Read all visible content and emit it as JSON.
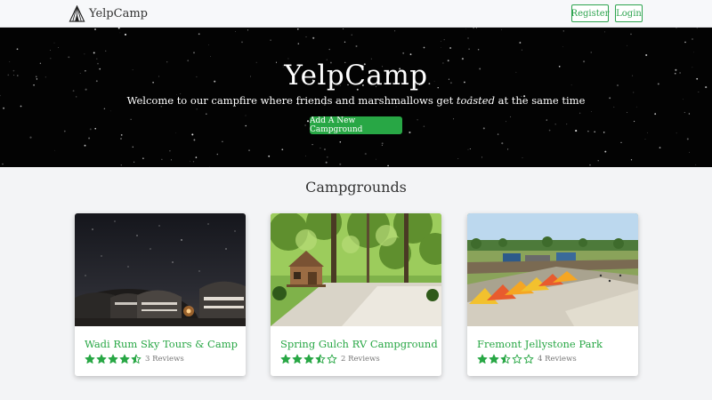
{
  "navbar": {
    "brand": "YelpCamp",
    "brand_icon": "tent-icon",
    "register_label": "Register",
    "login_label": "Login"
  },
  "hero": {
    "title": "YelpCamp",
    "subtitle_before": "Welcome to our campfire where friends and marshmallows get ",
    "subtitle_em": "toasted",
    "subtitle_after": " at the same time",
    "cta_label": "Add A New Campground"
  },
  "section": {
    "title": "Campgrounds"
  },
  "campgrounds": [
    {
      "name": "Wadi Rum Sky Tours & Camp",
      "rating": 4.5,
      "reviews": "3 Reviews"
    },
    {
      "name": "Spring Gulch RV Campground",
      "rating": 3.5,
      "reviews": "2 Reviews"
    },
    {
      "name": "Fremont Jellystone Park",
      "rating": 2.5,
      "reviews": "4 Reviews"
    }
  ],
  "colors": {
    "accent": "#28a745",
    "star": "#28a745",
    "hero_bg": "#030303"
  }
}
